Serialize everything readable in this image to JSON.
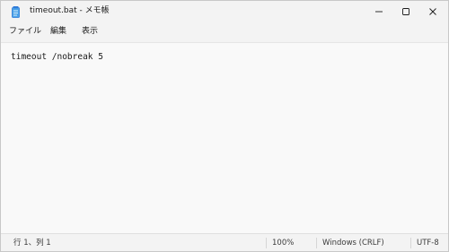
{
  "window": {
    "title": "timeout.bat - メモ帳"
  },
  "icons": {
    "app": "notepad-icon",
    "minimize": "minimize-icon",
    "maximize": "maximize-icon",
    "close": "close-icon"
  },
  "menu": {
    "file": "ファイル",
    "edit": "編集",
    "view": "表示"
  },
  "editor": {
    "content": "timeout /nobreak 5"
  },
  "status": {
    "position": "行 1、列 1",
    "zoom": "100%",
    "line_ending": "Windows (CRLF)",
    "encoding": "UTF-8"
  },
  "colors": {
    "accent": "#2f7ad8"
  }
}
